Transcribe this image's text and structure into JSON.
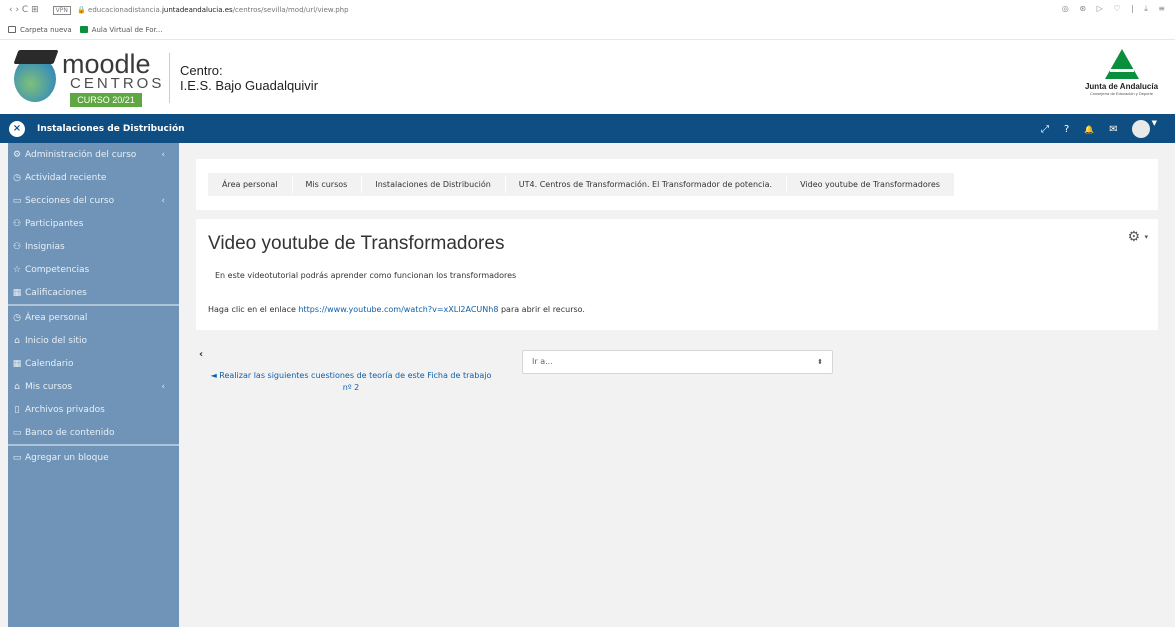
{
  "browser": {
    "nav_glyphs": "‹  ›  C  ⊞",
    "vpn": "VPN",
    "url_prefix": "educacionadistancia.",
    "url_domain": "juntadeandalucia.es",
    "url_path": "/centros/sevilla/mod/url/view.php",
    "right_icons": "◎ ⊛ ▷ ♡ | ⤓ ≡"
  },
  "bookmarks": [
    {
      "label": "Carpeta nueva"
    },
    {
      "label": "Aula Virtual de For..."
    }
  ],
  "header": {
    "logo_word": "moodle",
    "logo_sub": "CENTROS",
    "logo_badge": "CURSO 20/21",
    "centro_label": "Centro:",
    "centro_name": "I.E.S. Bajo Guadalquivir",
    "junta_name": "Junta de Andalucía",
    "junta_sub": "Consejería de Educación y Deporte"
  },
  "topnav": {
    "close_glyph": "×",
    "course_title": "Instalaciones de Distribución",
    "icons": {
      "expand": "⤢",
      "help": "?",
      "bell": "🔔",
      "mail": "✉"
    },
    "caret": "▼"
  },
  "sidebar": {
    "group1": [
      {
        "label": "Administración del curso",
        "icon": "⚙",
        "arrow": "‹"
      },
      {
        "label": "Actividad reciente",
        "icon": "◷",
        "arrow": ""
      },
      {
        "label": "Secciones del curso",
        "icon": "▭",
        "arrow": "‹"
      },
      {
        "label": "Participantes",
        "icon": "⚇",
        "arrow": ""
      },
      {
        "label": "Insignias",
        "icon": "⚇",
        "arrow": ""
      },
      {
        "label": "Competencias",
        "icon": "☆",
        "arrow": ""
      },
      {
        "label": "Calificaciones",
        "icon": "▦",
        "arrow": ""
      }
    ],
    "group2": [
      {
        "label": "Área personal",
        "icon": "◷",
        "arrow": ""
      },
      {
        "label": "Inicio del sitio",
        "icon": "⌂",
        "arrow": ""
      },
      {
        "label": "Calendario",
        "icon": "▦",
        "arrow": ""
      },
      {
        "label": "Mis cursos",
        "icon": "⌂",
        "arrow": "‹"
      },
      {
        "label": "Archivos privados",
        "icon": "▯",
        "arrow": ""
      },
      {
        "label": "Banco de contenido",
        "icon": "▭",
        "arrow": ""
      }
    ],
    "group3": [
      {
        "label": "Agregar un bloque",
        "icon": "▭",
        "arrow": ""
      }
    ]
  },
  "breadcrumb": [
    "Área personal",
    "Mis cursos",
    "Instalaciones de Distribución",
    "UT4. Centros de Transformación. El Transformador de potencia.",
    "Video youtube de Transformadores"
  ],
  "main": {
    "title": "Video youtube de Transformadores",
    "gear_glyph": "⚙",
    "gear_caret": "▾",
    "description": "En este videotutorial podrás aprender como funcionan los transformadores",
    "click_prefix": "Haga clic en el enlace ",
    "link_url": "https://www.youtube.com/watch?v=xXLl2ACUNh8",
    "click_suffix": " para abrir el recurso."
  },
  "activity_nav": {
    "back_chevron": "‹",
    "prev_link": "◄ Realizar las siguientes cuestiones de teoría de este Ficha de trabajo nº 2",
    "jump_placeholder": "Ir a...",
    "jump_arrow": "⬍"
  }
}
